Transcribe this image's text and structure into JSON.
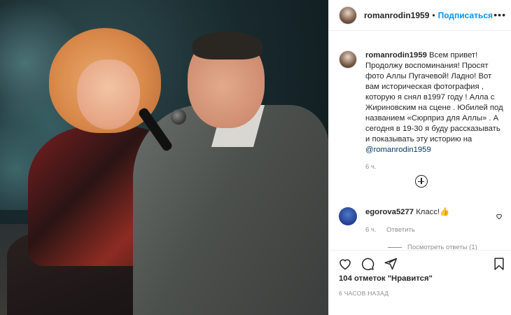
{
  "post": {
    "author": "romanrodin1959",
    "follow_label": "Подписаться",
    "more_label": "•••",
    "separator": "•"
  },
  "caption": {
    "username": "romanrodin1959",
    "text": " Всем привет! Продолжу воспоминания! Просят фото Аллы Пугачевой! Ладно! Вот вам историческая фотография , которую я снял в1997 году ! Алла с Жириновским на сцене . Юбилей под названием «Сюрприз для Аллы» . А сегодня в 19-30 я буду рассказывать и показывать эту историю на ",
    "mention": "@romanrodin1959",
    "time": "6 ч."
  },
  "comment": {
    "username": "egorova5277",
    "text": " Класс!👍",
    "time": "6 ч.",
    "reply_label": "Ответить",
    "view_replies": "Посмотреть ответы (1)"
  },
  "footer": {
    "likes": "104 отметок \"Нравится\"",
    "ago": "6 ЧАСОВ НАЗАД"
  },
  "icons": {
    "like": "heart-icon",
    "comment": "comment-icon",
    "share": "share-icon",
    "save": "bookmark-icon",
    "add": "plus-circle-icon"
  }
}
